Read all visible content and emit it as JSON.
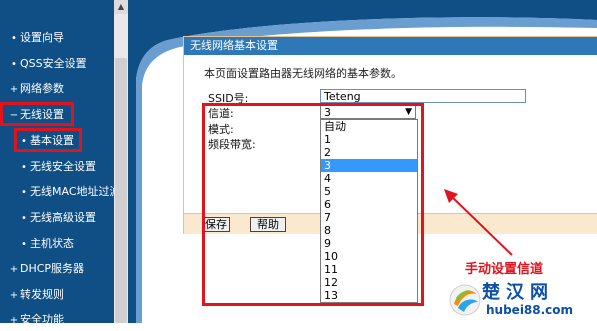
{
  "sidebar": {
    "items": [
      {
        "label": "设置向导",
        "bullet": "•"
      },
      {
        "label": "QSS安全设置",
        "bullet": "•"
      },
      {
        "label": "网络参数",
        "bullet": "+"
      },
      {
        "label": "无线设置",
        "bullet": "−"
      },
      {
        "label": "基本设置",
        "bullet": "•"
      },
      {
        "label": "无线安全设置",
        "bullet": "•"
      },
      {
        "label": "无线MAC地址过滤",
        "bullet": "•"
      },
      {
        "label": "无线高级设置",
        "bullet": "•"
      },
      {
        "label": "主机状态",
        "bullet": "•"
      },
      {
        "label": "DHCP服务器",
        "bullet": "+"
      },
      {
        "label": "转发规则",
        "bullet": "+"
      },
      {
        "label": "安全功能",
        "bullet": "+"
      }
    ]
  },
  "panel": {
    "title": "无线网络基本设置",
    "description": "本页面设置路由器无线网络的基本参数。",
    "ssid_label": "SSID号:",
    "ssid_value": "Teteng",
    "channel_label": "信道:",
    "channel_value": "3",
    "mode_label": "模式:",
    "bandwidth_label": "频段带宽:",
    "channel_options": [
      "自动",
      "1",
      "2",
      "3",
      "4",
      "5",
      "6",
      "7",
      "8",
      "9",
      "10",
      "11",
      "12",
      "13"
    ],
    "selected_option": "3",
    "save_label": "保存",
    "help_label": "帮助"
  },
  "annotation": {
    "text": "手动设置信道"
  },
  "logo": {
    "name": "楚汉网",
    "url": "hubei88.com"
  },
  "colors": {
    "sidebar_bg": "#0f4f86",
    "title_bar": "#2f78b7",
    "highlight_red": "#e0141e",
    "selected_option": "#3399ff"
  }
}
